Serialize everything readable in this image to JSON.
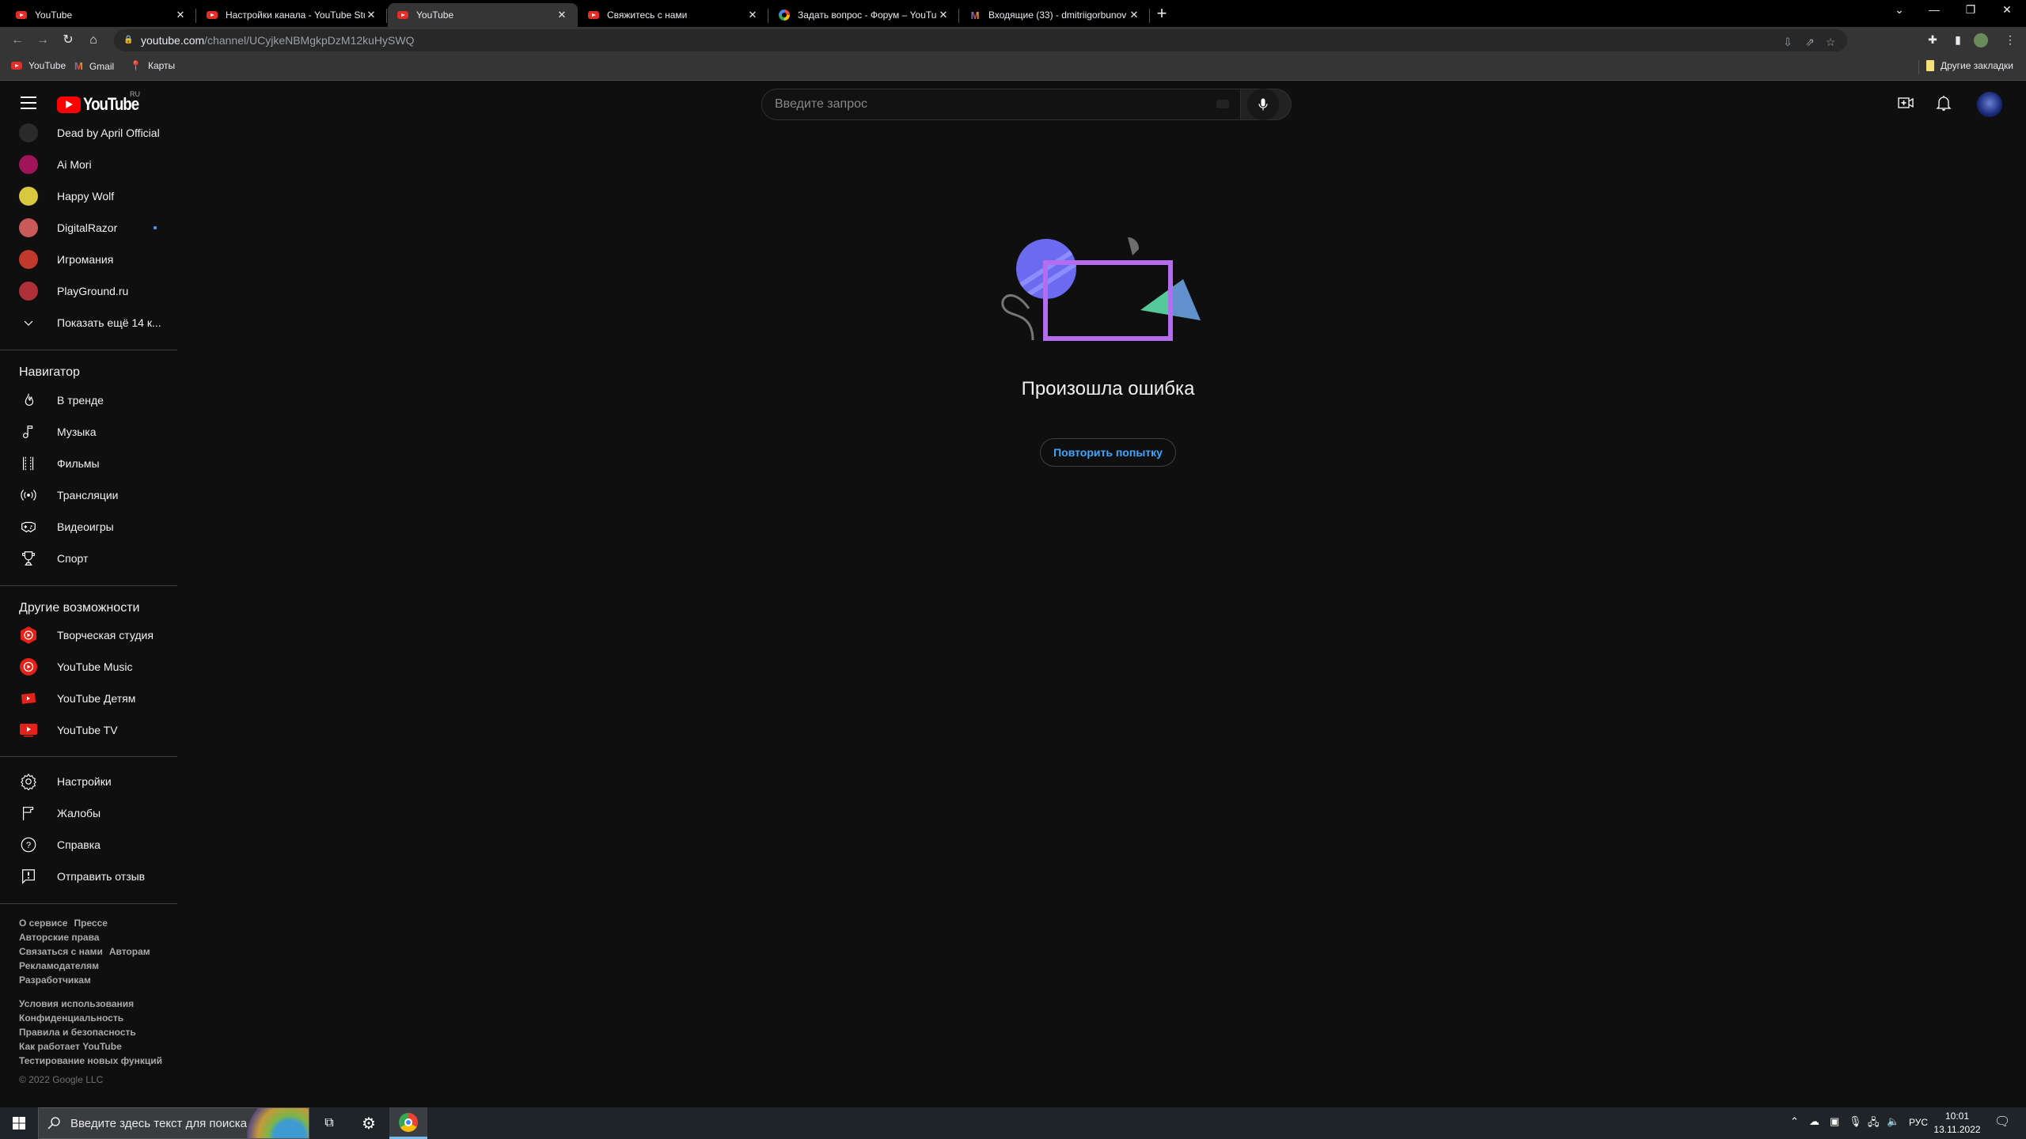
{
  "browser": {
    "tabs": [
      {
        "title": "YouTube",
        "favicon": "youtube-icon",
        "active": false
      },
      {
        "title": "Настройки канала - YouTube Studio",
        "favicon": "youtube-icon",
        "active": false
      },
      {
        "title": "YouTube",
        "favicon": "youtube-icon",
        "active": true
      },
      {
        "title": "Свяжитесь с нами",
        "favicon": "youtube-icon",
        "active": false
      },
      {
        "title": "Задать вопрос - Форум – YouTube",
        "favicon": "google-icon",
        "active": false
      },
      {
        "title": "Входящие (33) - dmitriigorbunov",
        "favicon": "gmail-icon",
        "active": false
      }
    ],
    "close_glyph": "✕",
    "new_tab_glyph": "+",
    "url_host": "youtube.com",
    "url_path": "/channel/UCyjkeNBMgkpDzM12kuHySWQ",
    "bookmarks": [
      {
        "label": "YouTube",
        "icon": "youtube-icon"
      },
      {
        "label": "Gmail",
        "icon": "gmail-icon"
      },
      {
        "label": "Карты",
        "icon": "maps-pin-icon"
      }
    ],
    "other_bookmarks": "Другие закладки"
  },
  "youtube": {
    "logo_text": "YouTube",
    "country_code": "RU",
    "search_placeholder": "Введите запрос",
    "subscriptions": [
      {
        "name": "Dead by April Official",
        "color": "#2a2a2a",
        "new": false
      },
      {
        "name": "Ai Mori",
        "color": "#a0155a",
        "new": false
      },
      {
        "name": "Happy Wolf",
        "color": "#d8c840",
        "new": false
      },
      {
        "name": "DigitalRazor",
        "color": "#c85a58",
        "new": true
      },
      {
        "name": "Игромания",
        "color": "#c0392b",
        "new": false
      },
      {
        "name": "PlayGround.ru",
        "color": "#b0303a",
        "new": false
      }
    ],
    "show_more": "Показать ещё 14 к...",
    "navigator_title": "Навигатор",
    "navigator": [
      {
        "label": "В тренде",
        "icon": "trending-flame-icon"
      },
      {
        "label": "Музыка",
        "icon": "music-note-icon"
      },
      {
        "label": "Фильмы",
        "icon": "film-icon"
      },
      {
        "label": "Трансляции",
        "icon": "live-broadcast-icon"
      },
      {
        "label": "Видеоигры",
        "icon": "gamepad-icon"
      },
      {
        "label": "Спорт",
        "icon": "trophy-icon"
      }
    ],
    "more_title": "Другие возможности",
    "more": [
      {
        "label": "Творческая студия",
        "icon": "youtube-studio-icon"
      },
      {
        "label": "YouTube Music",
        "icon": "youtube-music-icon"
      },
      {
        "label": "YouTube Детям",
        "icon": "youtube-kids-icon"
      },
      {
        "label": "YouTube TV",
        "icon": "youtube-tv-icon"
      }
    ],
    "settings": [
      {
        "label": "Настройки",
        "icon": "gear-icon"
      },
      {
        "label": "Жалобы",
        "icon": "flag-icon"
      },
      {
        "label": "Справка",
        "icon": "help-icon"
      },
      {
        "label": "Отправить отзыв",
        "icon": "feedback-icon"
      }
    ],
    "footer1": [
      [
        "О сервисе",
        "Прессе"
      ],
      [
        "Авторские права"
      ],
      [
        "Связаться с нами",
        "Авторам"
      ],
      [
        "Рекламодателям"
      ],
      [
        "Разработчикам"
      ]
    ],
    "footer2": [
      [
        "Условия использования"
      ],
      [
        "Конфиденциальность"
      ],
      [
        "Правила и безопасность"
      ],
      [
        "Как работает YouTube"
      ],
      [
        "Тестирование новых функций"
      ]
    ],
    "copyright": "© 2022 Google LLC",
    "error_title": "Произошла ошибка",
    "retry_label": "Повторить попытку",
    "accent_color": "#3ea6ff"
  },
  "taskbar": {
    "search_placeholder": "Введите здесь текст для поиска",
    "language": "РУС",
    "time": "10:01",
    "date": "13.11.2022"
  }
}
